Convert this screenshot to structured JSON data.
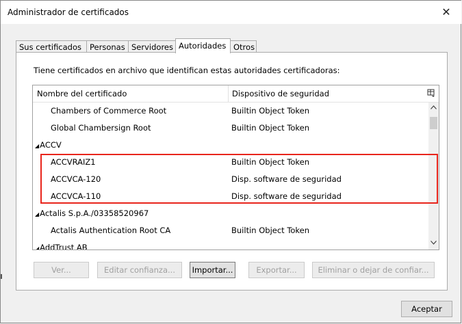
{
  "window": {
    "title": "Administrador de certificados",
    "close_glyph": "✕"
  },
  "tabs": [
    {
      "label": "Sus certificados",
      "active": false
    },
    {
      "label": "Personas",
      "active": false
    },
    {
      "label": "Servidores",
      "active": false
    },
    {
      "label": "Autoridades",
      "active": true
    },
    {
      "label": "Otros",
      "active": false
    }
  ],
  "panel": {
    "intro": "Tiene certificados en archivo que identifican estas autoridades certificadoras:"
  },
  "table": {
    "columns": [
      "Nombre del certificado",
      "Dispositivo de seguridad"
    ],
    "picker_icon": "column-picker-icon",
    "rows": [
      {
        "type": "item",
        "name": "Chambers of Commerce Root",
        "device": "Builtin Object Token"
      },
      {
        "type": "item",
        "name": "Global Chambersign Root",
        "device": "Builtin Object Token"
      },
      {
        "type": "group",
        "name": "ACCV",
        "expanded": true
      },
      {
        "type": "item",
        "name": "ACCVRAIZ1",
        "device": "Builtin Object Token"
      },
      {
        "type": "item",
        "name": "ACCVCA-120",
        "device": "Disp. software de seguridad"
      },
      {
        "type": "item",
        "name": "ACCVCA-110",
        "device": "Disp. software de seguridad"
      },
      {
        "type": "group",
        "name": "Actalis S.p.A./03358520967",
        "expanded": true
      },
      {
        "type": "item",
        "name": "Actalis Authentication Root CA",
        "device": "Builtin Object Token"
      },
      {
        "type": "group",
        "name": "AddTrust AB",
        "expanded": true
      }
    ]
  },
  "buttons": {
    "ver": "Ver...",
    "editar": "Editar confianza...",
    "importar": "Importar...",
    "exportar": "Exportar...",
    "eliminar": "Eliminar o dejar de confiar..."
  },
  "footer": {
    "ok": "Aceptar"
  },
  "colors": {
    "highlight": "#e8241b"
  }
}
